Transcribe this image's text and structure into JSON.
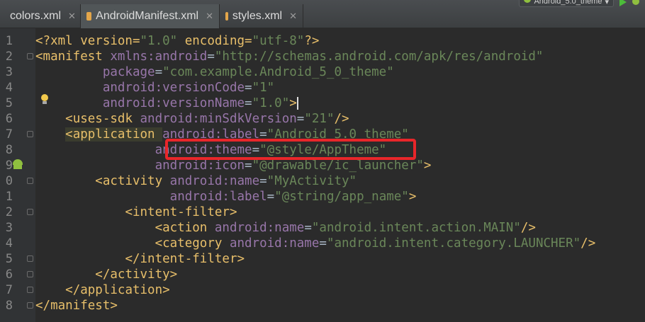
{
  "tabs": [
    {
      "label": "colors.xml",
      "icon": "xml-file-icon",
      "active": false
    },
    {
      "label": "AndroidManifest.xml",
      "icon": "xml-file-icon",
      "active": true
    },
    {
      "label": "styles.xml",
      "icon": "xml-file-icon",
      "active": false
    }
  ],
  "toolbar": {
    "run_config": "Android_5.0_theme"
  },
  "line_numbers": [
    "1",
    "2",
    "3",
    "4",
    "5",
    "6",
    "7",
    "8",
    "9",
    "0",
    "1",
    "2",
    "3",
    "4",
    "5",
    "6",
    "7",
    "8"
  ],
  "code": {
    "l1": {
      "a": "<?xml version=",
      "b": "\"1.0\"",
      "c": " encoding=",
      "d": "\"utf-8\"",
      "e": "?>"
    },
    "l2": {
      "a": "<manifest ",
      "b": "xmlns:",
      "c": "android",
      "d": "=",
      "e": "\"http://schemas.android.com/apk/res/android\""
    },
    "l3": {
      "a": "package",
      "b": "=",
      "c": "\"com.example.Android_5_0_theme\""
    },
    "l4": {
      "a": "android",
      "b": ":versionCode",
      "c": "=",
      "d": "\"1\""
    },
    "l5": {
      "a": "android",
      "b": ":versionName",
      "c": "=",
      "d": "\"1.0\"",
      "e": ">"
    },
    "l6": {
      "a": "<uses-sdk ",
      "b": "android",
      "c": ":minSdkVersion",
      "d": "=",
      "e": "\"21\"",
      "f": "/>"
    },
    "l7": {
      "a": "<application ",
      "b": "android",
      "c": ":label",
      "d": "=",
      "e": "\"Android 5.0 theme\""
    },
    "l8": {
      "a": "android",
      "b": ":theme",
      "c": "=",
      "d": "\"@style/AppTheme\""
    },
    "l9": {
      "a": "android",
      "b": ":icon",
      "c": "=",
      "d": "\"@drawable/ic_launcher\"",
      "e": ">"
    },
    "l10": {
      "a": "<activity ",
      "b": "android",
      "c": ":name",
      "d": "=",
      "e": "\"MyActivity\""
    },
    "l11": {
      "a": "android",
      "b": ":label",
      "c": "=",
      "d": "\"@string/app_name\"",
      "e": ">"
    },
    "l12": {
      "a": "<intent-filter>"
    },
    "l13": {
      "a": "<action ",
      "b": "android",
      "c": ":name",
      "d": "=",
      "e": "\"android.intent.action.MAIN\"",
      "f": "/>"
    },
    "l14": {
      "a": "<category ",
      "b": "android",
      "c": ":name",
      "d": "=",
      "e": "\"android.intent.category.LAUNCHER\"",
      "f": "/>"
    },
    "l15": {
      "a": "</intent-filter>"
    },
    "l16": {
      "a": "</activity>"
    },
    "l17": {
      "a": "</application>"
    },
    "l18": {
      "a": "</manifest>"
    }
  },
  "colors": {
    "accent_highlight": "#e8262a",
    "tag": "#e8bf6a",
    "string": "#6a8759",
    "attribute": "#9876aa"
  }
}
